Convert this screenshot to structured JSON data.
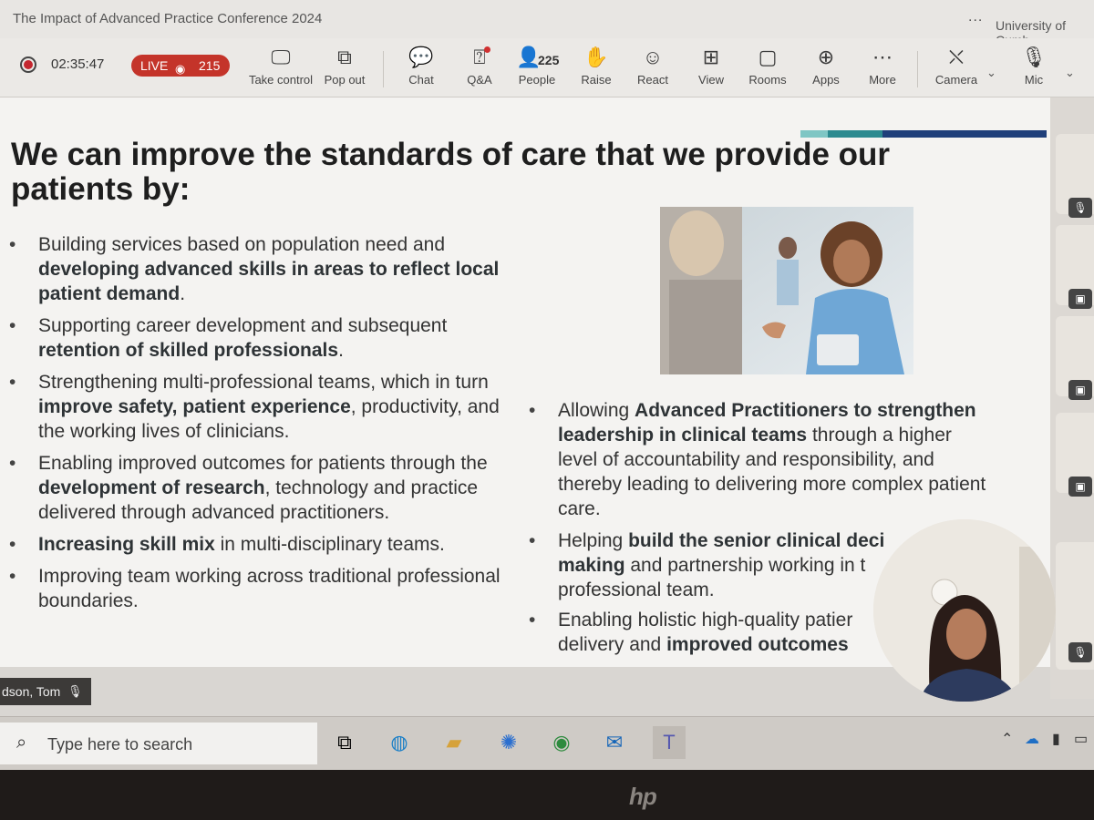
{
  "window": {
    "title": "The Impact of Advanced Practice Conference 2024",
    "more_dots": "...",
    "org": "University of Cumb"
  },
  "toolbar": {
    "timer": "02:35:47",
    "live_label": "LIVE",
    "viewers": "215",
    "buttons": {
      "take_control": "Take control",
      "pop_out": "Pop out",
      "chat": "Chat",
      "qa": "Q&A",
      "people": "People",
      "people_count": "225",
      "raise": "Raise",
      "react": "React",
      "view": "View",
      "rooms": "Rooms",
      "apps": "Apps",
      "more": "More",
      "camera": "Camera",
      "mic": "Mic"
    }
  },
  "slide": {
    "title": "We can improve the standards of care that we provide our patients by:",
    "left_bullets": [
      {
        "a": "Building services based on population need and ",
        "b": "developing advanced skills in areas to reflect local patient demand",
        "c": "."
      },
      {
        "a": "Supporting career development and subsequent ",
        "b": "retention of skilled professionals",
        "c": "."
      },
      {
        "a": "Strengthening multi-professional teams, which in turn ",
        "b": "improve safety, patient experience",
        "c": ", productivity, and the working lives of clinicians."
      },
      {
        "a": "Enabling improved outcomes for patients through the ",
        "b": "development of research",
        "c": ", technology and practice delivered through advanced practitioners."
      },
      {
        "a": "",
        "b": "Increasing skill mix",
        "c": " in multi-disciplinary teams."
      },
      {
        "a": "Improving team working across traditional professional boundaries.",
        "b": "",
        "c": ""
      }
    ],
    "right_bullets": [
      {
        "a": "Allowing ",
        "b": "Advanced Practitioners to strengthen leadership in clinical teams",
        "c": " through a higher level of accountability and responsibility, and thereby leading to delivering more complex patient care."
      },
      {
        "a": "Helping ",
        "b": "build the senior clinical deci",
        "c": ""
      },
      {
        "a": "",
        "b": "making",
        "c": " and partnership working in t"
      },
      {
        "a": "professional team.",
        "b": "",
        "c": ""
      },
      {
        "a": "Enabling holistic high-quality patier",
        "b": "",
        "c": ""
      },
      {
        "a": "delivery and ",
        "b": "improved outcomes",
        "c": ""
      }
    ]
  },
  "presenter": {
    "name": "dson, Tom"
  },
  "taskbar": {
    "search_placeholder": "Type here to search"
  },
  "colors": {
    "live": "#c4342a",
    "accent_teal": "#7fc6c4",
    "accent_navy": "#1f3f7a"
  }
}
